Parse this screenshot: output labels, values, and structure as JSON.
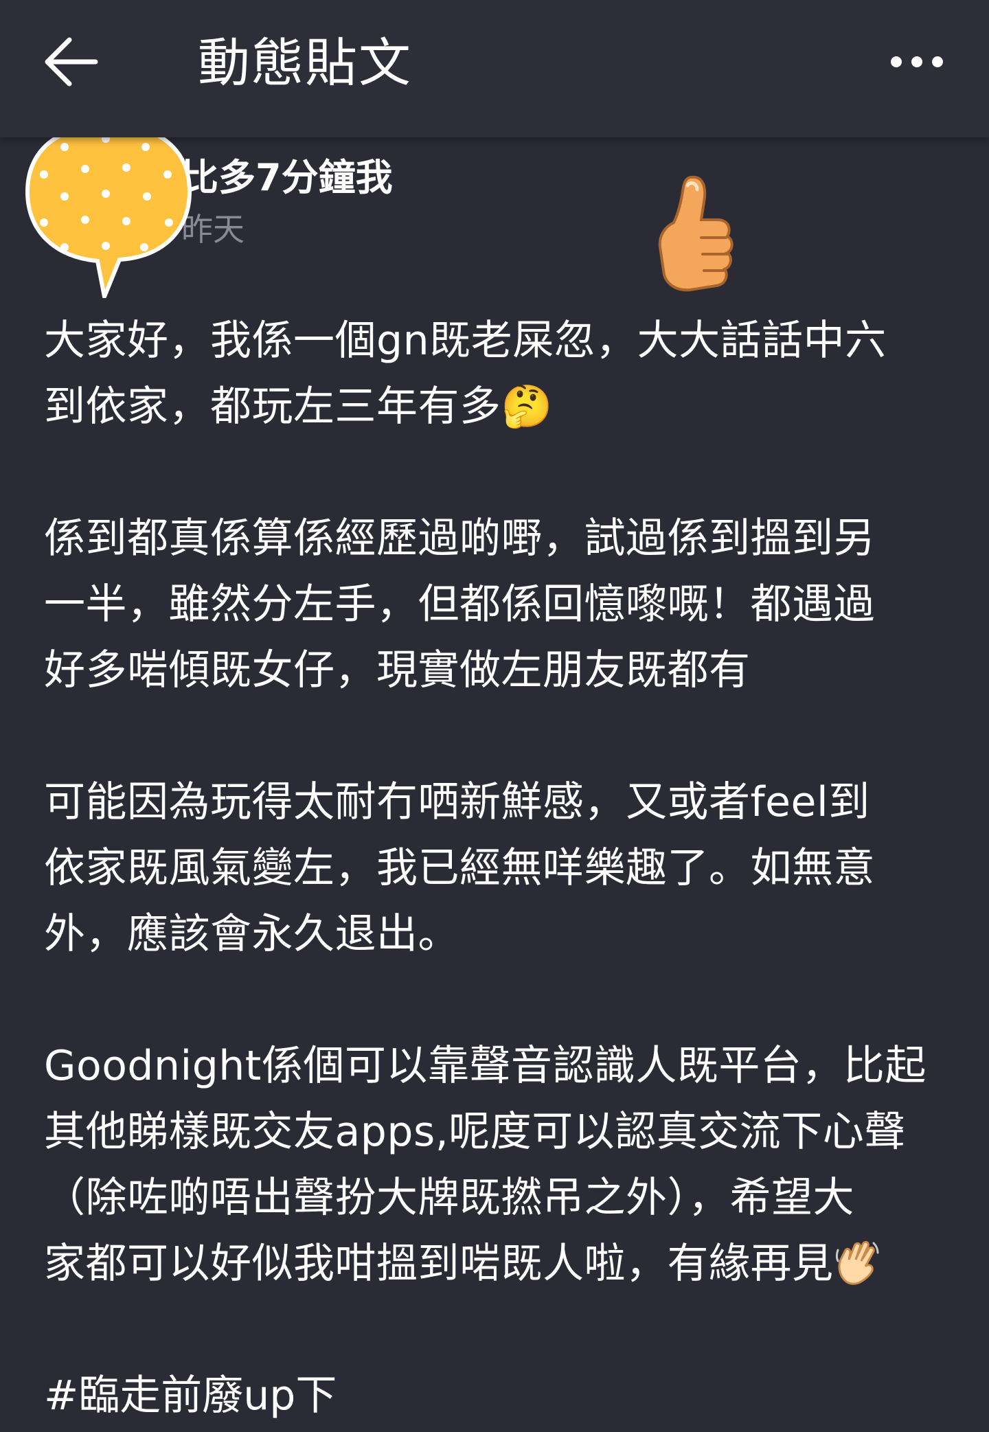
{
  "header": {
    "title": "動態貼文"
  },
  "author": {
    "name": "比多7分鐘我",
    "time": "昨天"
  },
  "post": {
    "paragraphs": [
      "大家好，我係一個gn既老屎忽，大大話話中六\n到依家，都玩左三年有多🤔",
      "係到都真係算係經歷過啲嘢，試過係到搵到另\n一半，雖然分左手，但都係回憶嚟嘅！都遇過\n好多啱傾既女仔，現實做左朋友既都有",
      "可能因為玩得太耐冇哂新鮮感，又或者feel到\n依家既風氣變左，我已經無咩樂趣了。如無意\n外，應該會永久退出。",
      "Goodnight係個可以靠聲音認識人既平台，比起\n其他睇樣既交友apps,呢度可以認真交流下心聲\n（除咗啲唔出聲扮大牌既撚吊之外），希望大\n家都可以好似我咁搵到啱既人啦，有緣再見"
    ],
    "hashtag": "#臨走前廢up下"
  },
  "icons": {
    "back": "arrow-left-icon",
    "more": "more-dots-icon",
    "avatar": "speech-bubble-avatar",
    "thumb": "thumbs-up-icon",
    "wave": "waving-hand-icon"
  }
}
